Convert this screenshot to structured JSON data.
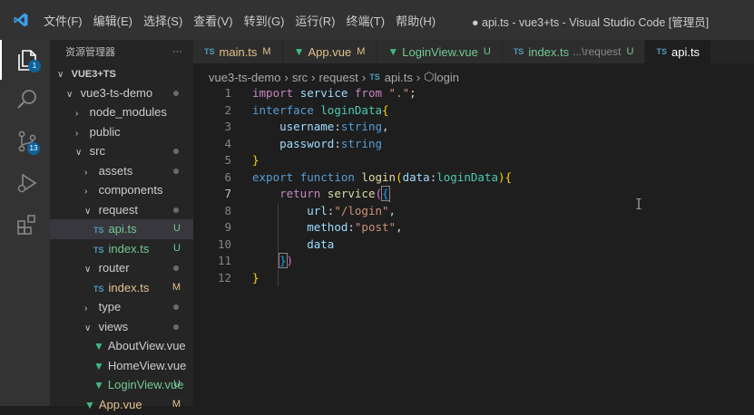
{
  "titlebar": {
    "menus": [
      "文件(F)",
      "编辑(E)",
      "选择(S)",
      "查看(V)",
      "转到(G)",
      "运行(R)",
      "终端(T)",
      "帮助(H)"
    ],
    "window_title": "● api.ts - vue3+ts - Visual Studio Code [管理员]"
  },
  "activity": {
    "explorer_badge": "1",
    "scm_badge": "13"
  },
  "sidebar": {
    "header": "资源管理器",
    "more": "···",
    "rows": [
      {
        "label": "VUE3+TS",
        "chev": "∨",
        "depth": 0,
        "bold": true
      },
      {
        "label": "vue3-ts-demo",
        "chev": "∨",
        "depth": 1,
        "dot": true
      },
      {
        "label": "node_modules",
        "chev": "›",
        "depth": 2
      },
      {
        "label": "public",
        "chev": "›",
        "depth": 2
      },
      {
        "label": "src",
        "chev": "∨",
        "depth": 2,
        "dot": true
      },
      {
        "label": "assets",
        "chev": "›",
        "depth": 3,
        "dot": true
      },
      {
        "label": "components",
        "chev": "›",
        "depth": 3
      },
      {
        "label": "request",
        "chev": "∨",
        "depth": 3,
        "dot": true
      },
      {
        "label": "api.ts",
        "file": "ts",
        "depth": 4,
        "marker": "U",
        "selected": true
      },
      {
        "label": "index.ts",
        "file": "ts",
        "depth": 4,
        "marker": "U"
      },
      {
        "label": "router",
        "chev": "∨",
        "depth": 3,
        "dot": true
      },
      {
        "label": "index.ts",
        "file": "ts",
        "depth": 4,
        "marker": "M"
      },
      {
        "label": "type",
        "chev": "›",
        "depth": 3,
        "dot": true
      },
      {
        "label": "views",
        "chev": "∨",
        "depth": 3,
        "dot": true
      },
      {
        "label": "AboutView.vue",
        "file": "vue",
        "depth": 4
      },
      {
        "label": "HomeView.vue",
        "file": "vue",
        "depth": 4
      },
      {
        "label": "LoginView.vue",
        "file": "vue",
        "depth": 4,
        "marker": "U"
      },
      {
        "label": "App.vue",
        "file": "vue",
        "depth": 3,
        "marker": "M"
      }
    ]
  },
  "tabs": [
    {
      "icon": "TS",
      "label": "main.ts",
      "mark": "M"
    },
    {
      "icon": "V",
      "label": "App.vue",
      "mark": "M"
    },
    {
      "icon": "V",
      "label": "LoginView.vue",
      "mark": "U"
    },
    {
      "icon": "TS",
      "label": "index.ts",
      "extra": "...\\request",
      "mark": "U"
    },
    {
      "icon": "TS",
      "label": "api.ts",
      "active": true
    }
  ],
  "breadcrumb": {
    "parts": [
      "vue3-ts-demo",
      "src",
      "request"
    ],
    "file_icon": "TS",
    "file": "api.ts",
    "symbol": "login"
  },
  "editor": {
    "current_line": 7,
    "lines": [
      [
        [
          "kw-ctrl",
          "import "
        ],
        [
          "ident",
          "service "
        ],
        [
          "kw-ctrl",
          "from "
        ],
        [
          "str",
          "\".\""
        ],
        [
          "punc",
          ";"
        ]
      ],
      [
        [
          "kw-blue",
          "interface "
        ],
        [
          "type",
          "loginData"
        ],
        [
          "brace-y",
          "{"
        ]
      ],
      [
        [
          "punc",
          "    "
        ],
        [
          "ident",
          "username"
        ],
        [
          "punc",
          ":"
        ],
        [
          "kw-blue",
          "string"
        ],
        [
          "punc",
          ","
        ]
      ],
      [
        [
          "punc",
          "    "
        ],
        [
          "ident",
          "password"
        ],
        [
          "punc",
          ":"
        ],
        [
          "kw-blue",
          "string"
        ]
      ],
      [
        [
          "brace-y",
          "}"
        ]
      ],
      [
        [
          "kw-blue",
          "export "
        ],
        [
          "kw-blue",
          "function "
        ],
        [
          "fn",
          "login"
        ],
        [
          "brace-y",
          "("
        ],
        [
          "ident",
          "data"
        ],
        [
          "punc",
          ":"
        ],
        [
          "type",
          "loginData"
        ],
        [
          "brace-y",
          ")"
        ],
        [
          "brace-y",
          "{"
        ]
      ],
      [
        [
          "punc",
          "    "
        ],
        [
          "kw-ctrl",
          "return "
        ],
        [
          "fn",
          "service"
        ],
        [
          "brace-p",
          "("
        ],
        [
          "brace-b hl",
          "{"
        ]
      ],
      [
        [
          "punc",
          "        "
        ],
        [
          "ident",
          "url"
        ],
        [
          "punc",
          ":"
        ],
        [
          "str",
          "\"/login\""
        ],
        [
          "punc",
          ","
        ]
      ],
      [
        [
          "punc",
          "        "
        ],
        [
          "ident",
          "method"
        ],
        [
          "punc",
          ":"
        ],
        [
          "str",
          "\"post\""
        ],
        [
          "punc",
          ","
        ]
      ],
      [
        [
          "punc",
          "        "
        ],
        [
          "ident",
          "data"
        ]
      ],
      [
        [
          "punc",
          "    "
        ],
        [
          "brace-b hl",
          "}"
        ],
        [
          "brace-p",
          ")"
        ]
      ],
      [
        [
          "brace-y",
          "}"
        ]
      ]
    ]
  }
}
